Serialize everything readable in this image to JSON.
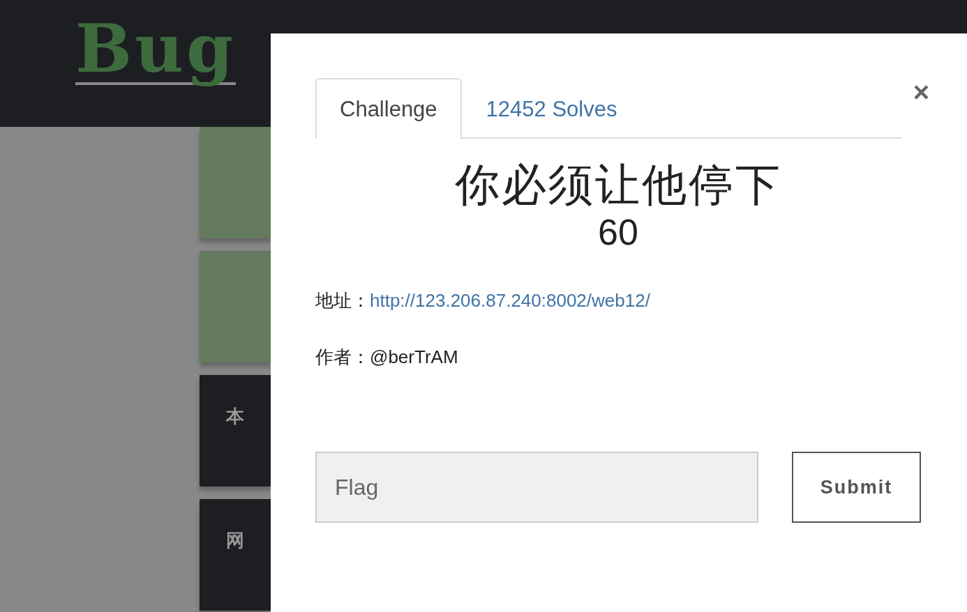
{
  "navbar": {
    "logo": "Bug"
  },
  "cards": [
    {
      "kind": "green"
    },
    {
      "kind": "green"
    },
    {
      "kind": "dark",
      "text": "本"
    },
    {
      "kind": "dark",
      "text": "网"
    }
  ],
  "modal": {
    "close": "×",
    "tabs": [
      {
        "label": "Challenge",
        "selected": true
      },
      {
        "label": "12452 Solves",
        "selected": false
      }
    ],
    "title": "你必须让他停下",
    "score": "60",
    "details": [
      {
        "label": "地址：",
        "value": "http://123.206.87.240:8002/web12/",
        "kind": "link"
      },
      {
        "label": "作者：",
        "value": "@berTrAM",
        "kind": "text"
      }
    ],
    "flag": {
      "placeholder": "Flag"
    },
    "submit": "Submit"
  }
}
